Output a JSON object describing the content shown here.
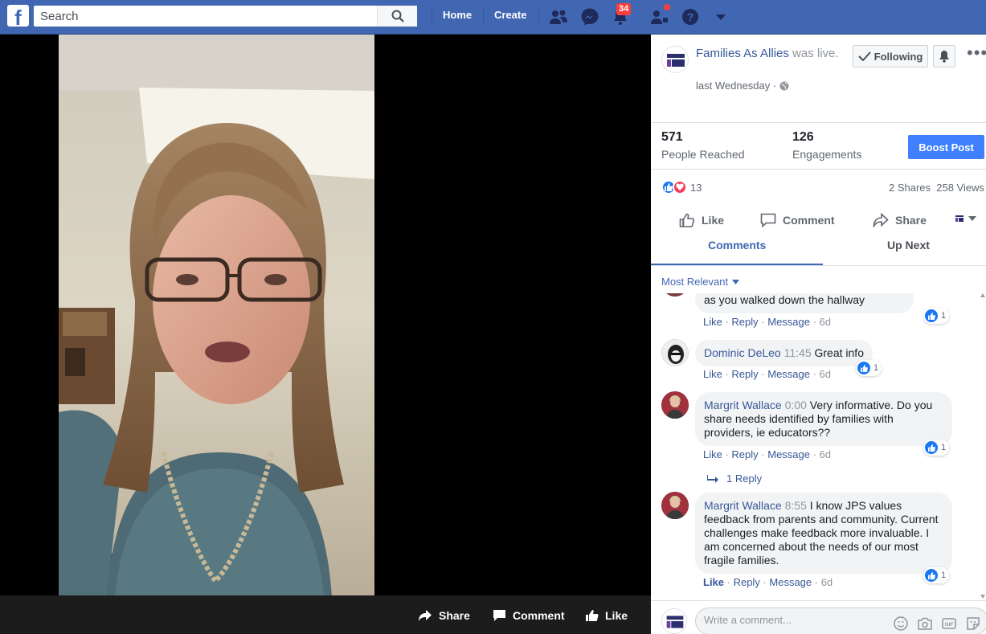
{
  "topbar": {
    "logo": "f",
    "search_placeholder": "Search",
    "nav": {
      "home": "Home",
      "create": "Create"
    },
    "notification_count": "34",
    "icons": [
      "search-icon",
      "friends-icon",
      "messenger-icon",
      "notifications-icon",
      "friend-requests-icon",
      "help-icon",
      "dropdown-icon"
    ]
  },
  "video": {
    "actions": {
      "share": "Share",
      "comment": "Comment",
      "like": "Like"
    }
  },
  "post": {
    "page_name": "Families As Allies",
    "status": "was live.",
    "time": "last Wednesday ·",
    "follow_label": "Following",
    "stats": {
      "reached_value": "571",
      "reached_label": "People Reached",
      "engagements_value": "126",
      "engagements_label": "Engagements"
    },
    "boost_label": "Boost Post",
    "reaction_count": "13",
    "shares_views": "2 Shares  258 Views",
    "actions": {
      "like": "Like",
      "comment": "Comment",
      "share": "Share"
    },
    "tabs": {
      "comments": "Comments",
      "up_next": "Up Next"
    },
    "sort_label": "Most Relevant"
  },
  "comments": [
    {
      "name": "",
      "time": "",
      "text": "as you walked down the hallway",
      "like": "Like",
      "reply": "Reply",
      "message": "Message",
      "age": "6d",
      "reactions": "1"
    },
    {
      "name": "Dominic DeLeo",
      "time": "11:45",
      "text": "Great info",
      "like": "Like",
      "reply": "Reply",
      "message": "Message",
      "age": "6d",
      "reactions": "1"
    },
    {
      "name": "Margrit Wallace",
      "time": "0:00",
      "text": "Very informative. Do you share needs identified by families with providers, ie educators??",
      "like": "Like",
      "reply": "Reply",
      "message": "Message",
      "age": "6d",
      "reactions": "1",
      "replies": "1 Reply"
    },
    {
      "name": "Margrit Wallace",
      "time": "8:55",
      "text": "I know JPS values feedback from parents and community. Current challenges make feedback more invaluable. I am concerned about the needs of our most fragile families.",
      "like": "Like",
      "reply": "Reply",
      "message": "Message",
      "age": "6d",
      "reactions": "1"
    }
  ],
  "composer": {
    "placeholder": "Write a comment..."
  },
  "colors": {
    "brand": "#4267b2",
    "link": "#385898",
    "boost": "#4080ff",
    "badge": "#fa3e3e"
  }
}
